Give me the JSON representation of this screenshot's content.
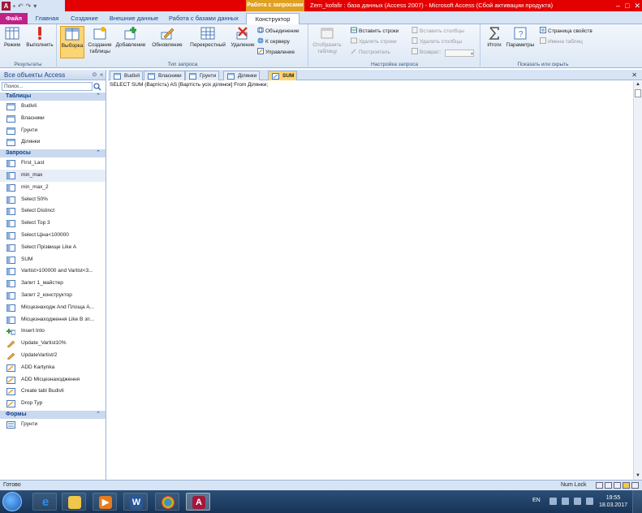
{
  "titlebar": {
    "contextual_tab": "Работа с запросами",
    "title": "Zem_kofafir : база данных (Access 2007) - Microsoft Access (Сбой активации продукта)",
    "controls": [
      "–",
      "□",
      "✕"
    ]
  },
  "ribbon_tabs": [
    "Файл",
    "Главная",
    "Создание",
    "Внешние данные",
    "Работа с базами данных",
    "Конструктор"
  ],
  "ribbon": {
    "groups": {
      "results": "Результаты",
      "query_type": "Тип запроса",
      "query_setup": "Настройка запроса",
      "show_hide": "Показать или скрыть"
    },
    "results_buttons": [
      "Режим",
      "Выполнить"
    ],
    "query_type_buttons": [
      "Выборка",
      "Создание таблицы",
      "Добавление",
      "Обновление",
      "Перекрестный",
      "Удаление"
    ],
    "query_type_small": [
      "Объединение",
      "К серверу",
      "Управление"
    ],
    "show_table": "Отобразить таблицу",
    "setup_small": [
      "Вставить строки",
      "Удалить строки",
      "Построитель",
      "Вставить столбцы",
      "Удалить столбцы",
      "Возврат:"
    ],
    "show_hide_buttons": [
      "Итоги",
      "Параметры"
    ],
    "show_hide_small": [
      "Страница свойств",
      "Имена таблиц"
    ]
  },
  "nav": {
    "header": "Все объекты Access",
    "search_placeholder": "Поиск...",
    "sections": [
      {
        "title": "Таблицы",
        "items": [
          "Budivli",
          "Власники",
          "Грунти",
          "Ділянки"
        ]
      },
      {
        "title": "Запросы",
        "items": [
          "First_Last",
          "min_max",
          "min_max_2",
          "Select 50%",
          "Select Distinct",
          "Select Top 3",
          "Select Ціна<100000",
          "Select Прізвище Like A",
          "SUM",
          "Vartist>100000 and Vartist<3...",
          "Запит 1_майстер",
          "Запит 2_конструктор",
          "Місцезнаходж And Площа A...",
          "Місцезнаходження Like B зп...",
          "Insert Into",
          "Update_Vartist10%",
          "UpdateVartist/2",
          "ADD Kartynka",
          "ADD Місцезнаходження",
          "Create tabl Budivli",
          "Drop Typ"
        ]
      },
      {
        "title": "Формы",
        "items": [
          "Грунти"
        ]
      }
    ]
  },
  "doc_tabs": [
    "Budivli",
    "Власники",
    "Грунти",
    "Ділянки",
    "SUM"
  ],
  "sql_text": "SELECT SUM (Вартість) AS [Вартість усіх ділянок] From Ділянки;",
  "status": {
    "ready": "Готово",
    "num_lock": "Num Lock"
  },
  "taskbar": {
    "lang": "EN",
    "time": "19:55",
    "date": "18.03.2017"
  },
  "colors": {
    "access_red": "#e30000",
    "ribbon_blue": "#d6e4f5",
    "highlight": "#fbd474",
    "file_tab": "#c0228a"
  }
}
